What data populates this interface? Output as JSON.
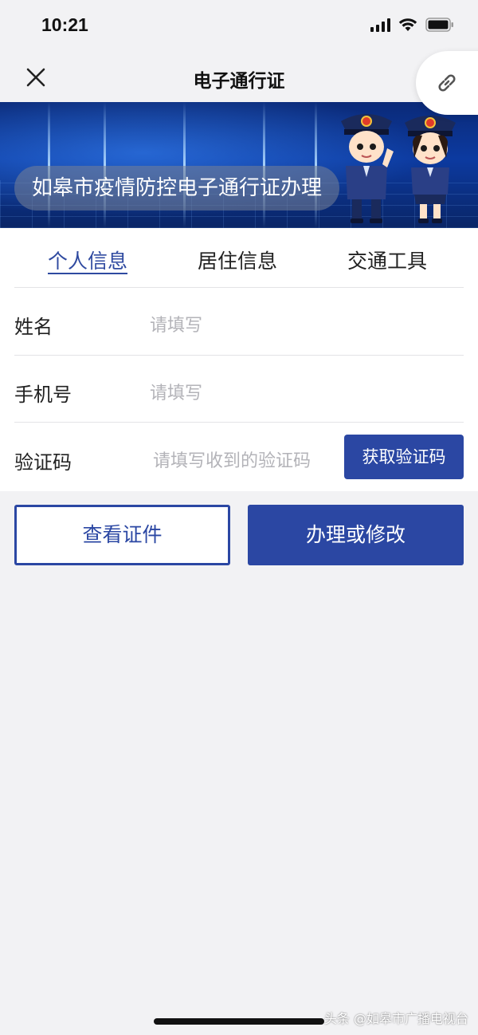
{
  "status_bar": {
    "time": "10:21"
  },
  "nav": {
    "title": "电子通行证"
  },
  "banner": {
    "caption": "如皋市疫情防控电子通行证办理"
  },
  "tabs": [
    {
      "label": "个人信息",
      "active": true
    },
    {
      "label": "居住信息",
      "active": false
    },
    {
      "label": "交通工具",
      "active": false
    }
  ],
  "form": {
    "name": {
      "label": "姓名",
      "placeholder": "请填写",
      "value": ""
    },
    "phone": {
      "label": "手机号",
      "placeholder": "请填写",
      "value": ""
    },
    "code": {
      "label": "验证码",
      "placeholder": "请填写收到的验证码",
      "value": "",
      "button": "获取验证码"
    }
  },
  "actions": {
    "view": "查看证件",
    "apply": "办理或修改"
  },
  "watermark": "头条 @如皋市广播电视台",
  "colors": {
    "accent": "#2b47a3",
    "background": "#f2f2f4",
    "banner": "#0c3aa0"
  }
}
